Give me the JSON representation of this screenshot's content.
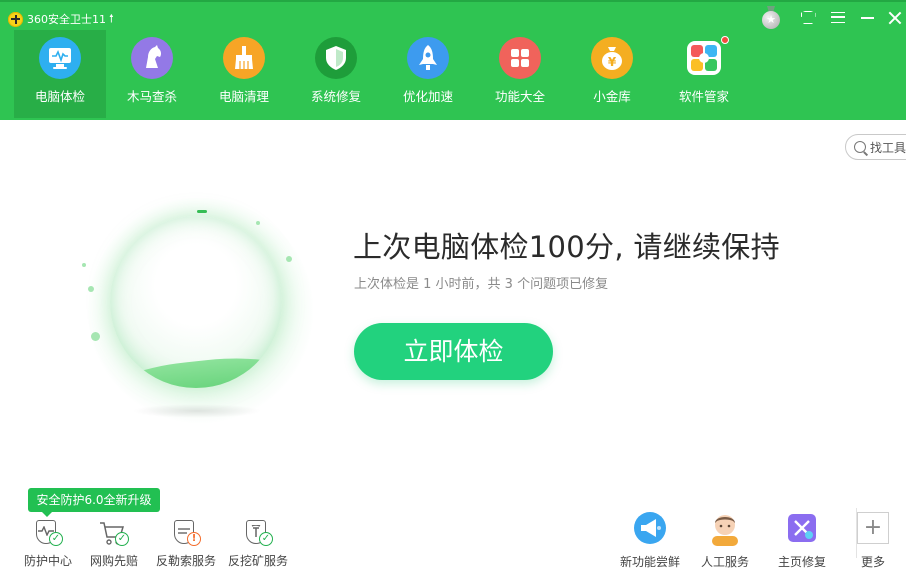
{
  "app": {
    "title": "360安全卫士11",
    "update_icon": "up-arrow-icon",
    "colors": {
      "header": "#2fc452",
      "accent_button": "#22d27e",
      "active_tab": "#28ae47"
    }
  },
  "window_controls": {
    "medal_icon": "medal-icon",
    "medal_glyph": "★",
    "skin_icon": "shirt-icon",
    "menu_icon": "menu-icon",
    "minimize_icon": "minimize-icon",
    "close_icon": "close-icon"
  },
  "tabs": [
    {
      "label": "电脑体检",
      "icon": "monitor-icon",
      "active": true
    },
    {
      "label": "木马查杀",
      "icon": "horse-icon",
      "active": false
    },
    {
      "label": "电脑清理",
      "icon": "broom-icon",
      "active": false
    },
    {
      "label": "系统修复",
      "icon": "shield-icon",
      "active": false
    },
    {
      "label": "优化加速",
      "icon": "rocket-icon",
      "active": false
    },
    {
      "label": "功能大全",
      "icon": "grid-icon",
      "active": false
    },
    {
      "label": "小金库",
      "icon": "yen-coin-icon",
      "active": false
    },
    {
      "label": "软件管家",
      "icon": "software-icon",
      "active": false
    }
  ],
  "toolbox": {
    "label": "找工具"
  },
  "main": {
    "headline": "上次电脑体检100分, 请继续保持",
    "subline": "上次体检是 1 小时前，共 3 个问题项已修复",
    "check_button": "立即体检"
  },
  "bottom_left": {
    "badge": "安全防护6.0全新升级",
    "items": [
      {
        "label": "防护中心",
        "icon": "protection-center-icon"
      },
      {
        "label": "网购先赔",
        "icon": "shopping-cart-icon"
      },
      {
        "label": "反勒索服务",
        "icon": "anti-ransomware-icon"
      },
      {
        "label": "反挖矿服务",
        "icon": "anti-mining-icon"
      }
    ]
  },
  "bottom_right": {
    "items": [
      {
        "label": "新功能尝鲜",
        "icon": "megaphone-icon"
      },
      {
        "label": "人工服务",
        "icon": "support-agent-icon"
      },
      {
        "label": "主页修复",
        "icon": "homepage-repair-icon"
      },
      {
        "label": "更多",
        "icon": "plus-icon",
        "glyph": "+"
      }
    ]
  }
}
